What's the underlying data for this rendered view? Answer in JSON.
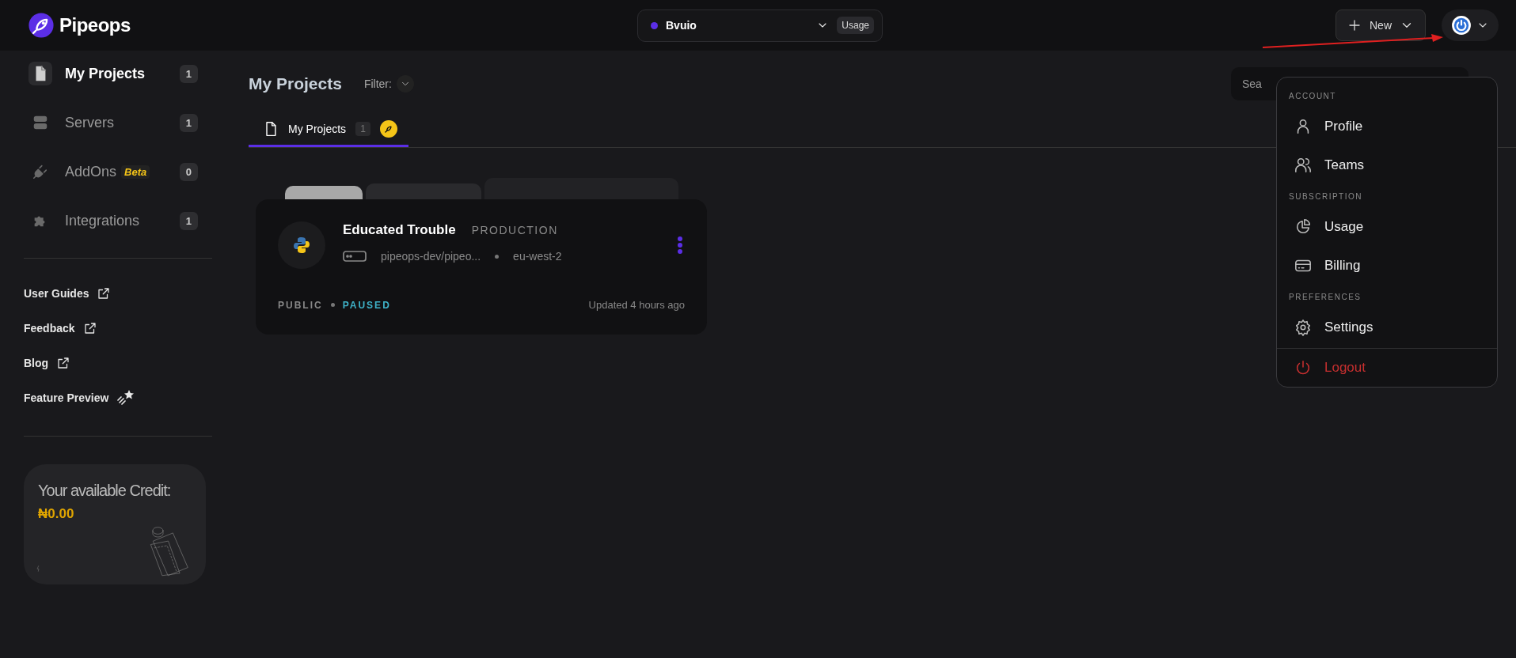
{
  "topbar": {
    "logo": "Pipeops",
    "workspace": {
      "name": "Bvuio",
      "badge": "Usage"
    },
    "new_button": "New"
  },
  "sidebar": {
    "nav": [
      {
        "label": "My Projects",
        "count": "1",
        "selected": true,
        "kind": "file"
      },
      {
        "label": "Servers",
        "count": "1",
        "selected": false,
        "kind": "server"
      },
      {
        "label": "AddOns",
        "badge": "Beta",
        "count": "0",
        "selected": false,
        "kind": "plug"
      },
      {
        "label": "Integrations",
        "count": "1",
        "selected": false,
        "kind": "puzzle"
      }
    ],
    "links": [
      {
        "label": "User Guides",
        "kind": "external"
      },
      {
        "label": "Feedback",
        "kind": "external"
      },
      {
        "label": "Blog",
        "kind": "external"
      },
      {
        "label": "Feature Preview",
        "kind": "preview"
      }
    ],
    "credit": {
      "title": "Your available Credit:",
      "amount": "₦0.00"
    }
  },
  "main": {
    "title": "My Projects",
    "filter_label": "Filter:",
    "search": {
      "placeholder": "Sea"
    },
    "tabs": [
      {
        "label": "My Projects",
        "count": "1",
        "selected": true
      }
    ],
    "projects": [
      {
        "name": "Educated Trouble",
        "environment": "PRODUCTION",
        "repo": "pipeops-dev/pipeo...",
        "region": "eu-west-2",
        "visibility": "PUBLIC",
        "status": "PAUSED",
        "updated": "Updated 4 hours ago"
      }
    ]
  },
  "account_menu": {
    "sections": [
      {
        "heading": "ACCOUNT",
        "items": [
          {
            "label": "Profile",
            "kind": "profile"
          },
          {
            "label": "Teams",
            "kind": "teams"
          }
        ]
      },
      {
        "heading": "SUBSCRIPTION",
        "items": [
          {
            "label": "Usage",
            "kind": "usage"
          },
          {
            "label": "Billing",
            "kind": "billing"
          }
        ]
      },
      {
        "heading": "PREFERENCES",
        "items": [
          {
            "label": "Settings",
            "kind": "settings"
          }
        ]
      }
    ],
    "logout": "Logout"
  }
}
